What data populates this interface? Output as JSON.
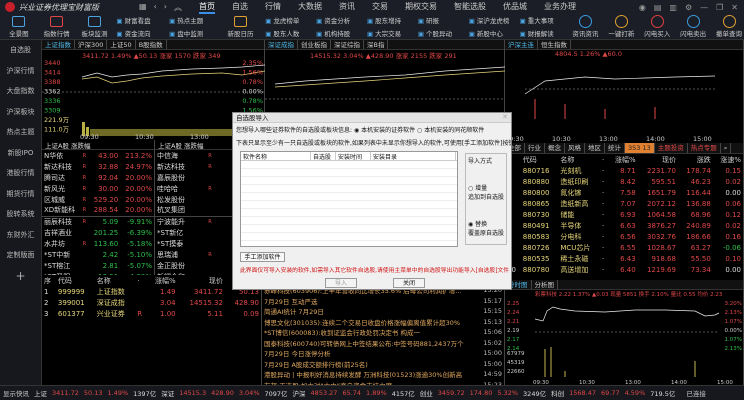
{
  "app": {
    "title": "兴业证券优理宝财富版",
    "menu": [
      "首页",
      "自选",
      "行情",
      "大数据",
      "资讯",
      "交易",
      "期权交易",
      "智能选股",
      "优品城",
      "业务办理"
    ],
    "active_menu": 0
  },
  "toolbar": {
    "big": [
      "全景图",
      "指数行情",
      "板块监测"
    ],
    "pairs": [
      [
        "财富看盘",
        "资金流向"
      ],
      [
        "热点主题",
        "盘中监测"
      ]
    ],
    "calendar": "新股日历",
    "pairs2": [
      [
        "龙虎榜单",
        "股东人数"
      ],
      [
        "资金分析",
        "机构持股"
      ],
      [
        "股东增持",
        "大宗交易"
      ],
      [
        "研报",
        "个股异动"
      ],
      [
        "深沪龙虎榜",
        "新股中心"
      ],
      [
        "重大事项",
        "财报解读"
      ]
    ],
    "circles": [
      {
        "label": "资讯资讯",
        "color": "#3a9be0"
      },
      {
        "label": "一键打新",
        "color": "#e0a030"
      },
      {
        "label": "闪电买入",
        "color": "#e04040"
      },
      {
        "label": "闪电卖出",
        "color": "#3a9be0"
      },
      {
        "label": "撤单查询",
        "color": "#e0a030"
      }
    ]
  },
  "sidebar": {
    "items": [
      "自选股",
      "沪深行情",
      "大盘指数",
      "沪深板块",
      "热点主题",
      "新股IPO",
      "港股行情",
      "期货行情",
      "股转系统",
      "东财外汇",
      "定制版面",
      "+"
    ]
  },
  "chart1": {
    "tabs": [
      "上证指数",
      "沪深300",
      "上证50",
      "B股指数"
    ],
    "header": "3411.72 1.49% ▲50.13 涨家 1570 跌家 349",
    "yticks": [
      "3440",
      "3414",
      "3388",
      "3362",
      "3336",
      "3309",
      "221.9万",
      "111.0万"
    ],
    "rticks": [
      "2.35%",
      "1.56%",
      "0.78%",
      "0.00%",
      "0.78%",
      "1.56%"
    ],
    "xticks": [
      "09:30",
      "10:30",
      "13:00",
      "14:00"
    ]
  },
  "chart2": {
    "tabs": [
      "深证成指",
      "创业板指",
      "深证综指",
      "深B指"
    ],
    "header": "14515.32 3.04% ▲428.90 涨家 2155 跌家 291"
  },
  "chart3": {
    "tabs": [
      "沪深主连",
      "恒生指数"
    ],
    "header": "4804.5 1.26% ▲60.0",
    "xticks": [
      "09:30",
      "10:30",
      "13:00",
      "14:00",
      "15:00"
    ]
  },
  "rank": {
    "left_title": "上证A股 涨跌幅",
    "right_title": "上证A股 涨跌幅",
    "left": [
      [
        "N华依",
        "R",
        "43.00",
        "213.2%",
        "red"
      ],
      [
        "新达科技",
        "R",
        "32.88",
        "24.97%",
        "red"
      ],
      [
        "腾司达",
        "R",
        "92.04",
        "20.00%",
        "red"
      ],
      [
        "新风光",
        "R",
        "30.00",
        "20.00%",
        "red"
      ],
      [
        "区城威",
        "R",
        "529.20",
        "20.00%",
        "red"
      ],
      [
        "XD新能科",
        "R",
        "288.54",
        "20.00%",
        "red"
      ],
      [
        "丽辰科技",
        "R",
        "5.09",
        "-9.91%",
        "grn"
      ],
      [
        "吉祥酒业",
        "",
        "201.25",
        "-6.39%",
        "grn"
      ],
      [
        "水井坊",
        "R",
        "113.60",
        "-5.18%",
        "grn"
      ],
      [
        "*ST中新",
        "",
        "2.42",
        "-5.10%",
        "grn"
      ],
      [
        "*ST榕江",
        "",
        "2.81",
        "-5.07%",
        "grn"
      ],
      [
        "*ST圣阳",
        "",
        "13.51",
        "-4.99%",
        "grn"
      ]
    ],
    "right": [
      [
        "中信海",
        "R",
        "252.58",
        "red"
      ],
      [
        "新达科技",
        "R",
        "32.88",
        "red"
      ],
      [
        "嘉辰股份",
        "",
        "38.00",
        "red"
      ],
      [
        "哇哈哈",
        "R",
        "45.10",
        "red"
      ],
      [
        "松发股份",
        "",
        "16.70",
        "red"
      ],
      [
        "杭叉集团",
        "",
        "15.98",
        "red"
      ],
      [
        "宁波能升",
        "R",
        "9.40",
        "red"
      ],
      [
        "*ST新亿",
        "",
        "1.50",
        "grn"
      ],
      [
        "*ST摸泰",
        "",
        "3.08",
        "red"
      ],
      [
        "思瑞浦",
        "R",
        "654.56",
        "red"
      ],
      [
        "金正股份",
        "",
        "43.00",
        "red"
      ],
      [
        "新耀众和",
        "",
        "0.51",
        "red"
      ]
    ]
  },
  "watch": {
    "headers": [
      "序",
      "代码",
      "名称",
      "·",
      "涨幅%",
      "现价",
      "涨跌"
    ],
    "rows": [
      [
        "1",
        "999999",
        "上证指数",
        "",
        "1.49",
        "3411.72",
        "50.13"
      ],
      [
        "2",
        "399001",
        "深证成指",
        "",
        "3.04",
        "14515.32",
        "428.90"
      ],
      [
        "3",
        "601377",
        "兴业证券",
        "R",
        "1.00",
        "5.11",
        "0.09"
      ]
    ]
  },
  "news": [
    [
      "赤峰科技(603906):上半年营收同比增长35.6% 后母公司利润扩增…",
      "15:20"
    ],
    [
      "7月29日 互动严选",
      "15:17"
    ],
    [
      "简通AI统计 7月29日",
      "15:15"
    ],
    [
      "博思文化(301035):连续二个交易日收盘价格涨幅偏离值累计超30%",
      "15:13"
    ],
    [
      "*ST博信(600083):收到证监会行政处罚决定书 构成一",
      "15:06"
    ],
    [
      "国泰科技(600740)可转债网上中签结果公布:中签号码881,2437万个",
      "15:02"
    ],
    [
      "7月29日 今日涨停分析",
      "15:00"
    ],
    [
      "7月29日 A股成交额排行榜(前25名)",
      "15:00"
    ],
    [
      "港股异动 | 中报利好消息持续发酵 万洲科技(01523)涨逾30%创新高",
      "14:59"
    ],
    [
      "友邦:正选股:加大对“大中”商户资金支持力度",
      "15:23"
    ]
  ],
  "sectors": {
    "tabs": [
      "全部",
      "行业",
      "概念",
      "风格",
      "地区",
      "统计"
    ],
    "badge": "353 13",
    "tabs2": [
      "主题投资",
      "热点专题"
    ],
    "headers": [
      "",
      "代码",
      "名称",
      "·",
      "涨幅%",
      "现价",
      "涨跌",
      "涨速%"
    ],
    "xticks": [
      "09:30",
      "10:30",
      "13:00",
      "14:00",
      "15:00"
    ],
    "rows": [
      [
        "1",
        "880716",
        "光刻机",
        "8.71",
        "2231.70",
        "178.74",
        "0.15"
      ],
      [
        "2",
        "880880",
        "造纸印刷",
        "8.42",
        "595.51",
        "46.23",
        "0.02"
      ],
      [
        "3",
        "880800",
        "氮化镓",
        "7.58",
        "1651.79",
        "116.44",
        "0.00"
      ],
      [
        "4",
        "880865",
        "造纸新高",
        "7.07",
        "2072.12",
        "136.88",
        "0.06"
      ],
      [
        "5",
        "880730",
        "储能",
        "6.93",
        "1064.58",
        "68.96",
        "0.12"
      ],
      [
        "6",
        "880491",
        "半导体",
        "6.63",
        "3876.27",
        "240.89",
        "0.02"
      ],
      [
        "7",
        "880583",
        "分电科",
        "6.56",
        "3032.76",
        "186.66",
        "0.16"
      ],
      [
        "8",
        "880726",
        "MCU芯片",
        "6.55",
        "1028.67",
        "63.27",
        "-0.06"
      ],
      [
        "9",
        "880535",
        "稀土永磁",
        "6.43",
        "918.68",
        "55.50",
        "0.10"
      ],
      [
        "10",
        "880780",
        "高送增加",
        "6.40",
        "1219.69",
        "73.34",
        "0.00"
      ]
    ]
  },
  "mini": {
    "tabs": [
      "分时图",
      "分析图"
    ],
    "header": "彩票科技 2.22 1.37% ▲0.03 现量 5851 换手 2.10% 量比 0.55 均价 2.23",
    "yticks": [
      "2.25",
      "2.24",
      "2.21",
      "2.19",
      "2.17",
      "2.14",
      "67979",
      "45319",
      "22660"
    ],
    "rticks": [
      "3.20%",
      "2.13%",
      "1.07%",
      "0.00%",
      "1.07%",
      "2.13%"
    ],
    "xticks": [
      "09:30",
      "10:30",
      "13:00",
      "14:00",
      "15:00"
    ],
    "connected": "已连接"
  },
  "dialog": {
    "title": "自选股导入",
    "question": "您想导入哪些证券软件的自选股或板块信息:",
    "opt1": "本机安装的证券软件",
    "opt2": "本机安装的同花顺软件",
    "note": "下表只显示至少有一只自选股或板块的软件,如果列表中未显示你想导入的软件,可使用[手工添加软件]按钮",
    "columns": [
      "软件名称",
      "自选股",
      "安装时间",
      "安装目录"
    ],
    "mode_title": "导入方式",
    "mode1": "增量",
    "mode1_desc": "追加到自选股",
    "mode2": "替换",
    "mode2_desc": "覆盖原自选股",
    "selected_mode": "替换",
    "manual": "手工添加软件",
    "warning": "此界面仅可导入安装的软件,如需导入其它软件自选股,请使用主菜单中的自选股导出功能导入[自选股]文件",
    "import": "导入",
    "close": "关闭"
  },
  "status": {
    "show": "显示快讯",
    "items": [
      [
        "上证",
        "3411.72",
        "50.13",
        "1.49%",
        "1397亿"
      ],
      [
        "深证",
        "14515.3",
        "428.90",
        "3.04%",
        "7097亿"
      ],
      [
        "沪深",
        "4853.27",
        "65.74",
        "1.89%",
        "4157亿"
      ],
      [
        "创业",
        "3459.72",
        "174.80",
        "5.32%",
        "3249亿"
      ],
      [
        "科创",
        "1568.47",
        "69.77",
        "4.59%",
        "719.5亿"
      ]
    ]
  }
}
